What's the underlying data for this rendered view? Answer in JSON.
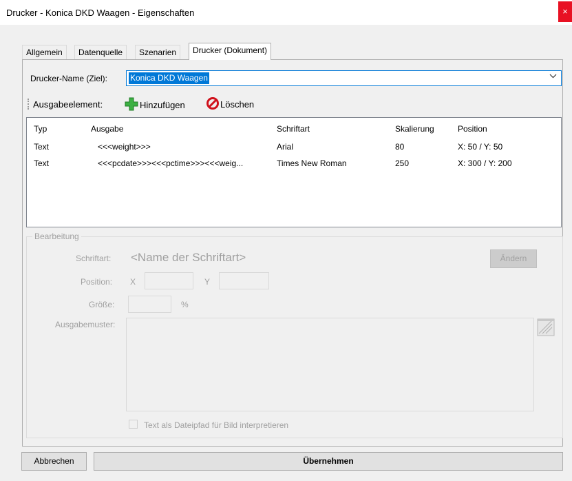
{
  "window": {
    "title": "Drucker - Konica DKD Waagen - Eigenschaften",
    "close_glyph": "×"
  },
  "tabs": [
    {
      "label": "Allgemein",
      "active": false
    },
    {
      "label": "Datenquelle",
      "active": false
    },
    {
      "label": "Szenarien",
      "active": false
    },
    {
      "label": "Drucker (Dokument)",
      "active": true
    }
  ],
  "printer": {
    "label": "Drucker-Name (Ziel):",
    "value": "Konica DKD Waagen"
  },
  "toolbar": {
    "label": "Ausgabeelement:",
    "add_label": "Hinzufügen",
    "delete_label": "Löschen",
    "add_icon": "plus-icon",
    "delete_icon": "prohibited-icon"
  },
  "list": {
    "columns": [
      "Typ",
      "Ausgabe",
      "Schriftart",
      "Skalierung",
      "Position"
    ],
    "rows": [
      [
        "Text",
        "<<<weight>>>",
        "Arial",
        "80",
        "X: 50 / Y: 50"
      ],
      [
        "Text",
        "<<<pcdate>>><<<pctime>>><<<weig...",
        "Times New Roman",
        "250",
        "X: 300 / Y: 200"
      ]
    ]
  },
  "edit": {
    "legend": "Bearbeitung",
    "font_label": "Schriftart:",
    "font_value": "<Name der Schriftart>",
    "change_button": "Ändern",
    "position_label": "Position:",
    "x_label": "X",
    "y_label": "Y",
    "size_label": "Größe:",
    "size_unit": "%",
    "pattern_label": "Ausgabemuster:",
    "checkbox_label": "Text als Dateipfad für Bild interpretieren"
  },
  "buttons": {
    "cancel": "Abbrechen",
    "apply": "Übernehmen"
  },
  "colors": {
    "accent": "#0078d7",
    "close": "#e81123",
    "disabled": "#a0a0a0"
  }
}
